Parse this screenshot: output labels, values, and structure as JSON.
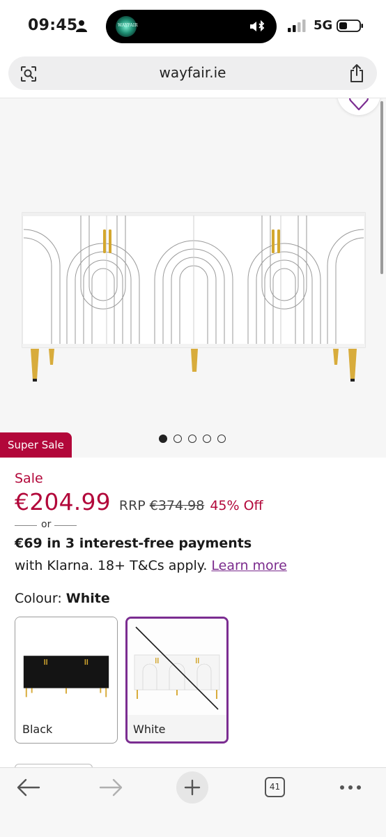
{
  "status_bar": {
    "time": "09:45",
    "network": "5G",
    "island_app_text": "WAYFAIR"
  },
  "browser": {
    "url": "wayfair.ie",
    "tab_count": "41"
  },
  "product": {
    "badge": "Super Sale",
    "carousel": {
      "total": 5,
      "active": 1
    },
    "sale_label": "Sale",
    "price": "€204.99",
    "rrp_label": "RRP",
    "rrp_value": "€374.98",
    "discount": "45% Off",
    "or_text": "or",
    "klarna_main": "€69 in 3 interest-free payments",
    "klarna_sub": "with Klarna. 18+ T&Cs apply.",
    "learn_more": "Learn more",
    "colour_label": "Colour:",
    "colour_value": "White",
    "swatches": [
      {
        "label": "Black",
        "selected": false
      },
      {
        "label": "White",
        "selected": true,
        "unavailable": true
      }
    ]
  },
  "colors": {
    "sale_red": "#b2073a",
    "selected_purple": "#7b2d91",
    "link_purple": "#7a2a8c"
  }
}
